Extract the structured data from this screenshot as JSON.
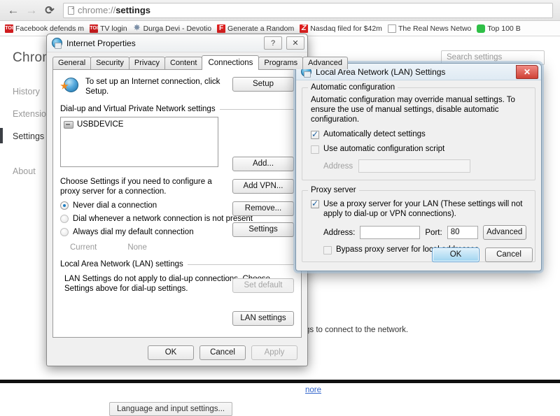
{
  "browser": {
    "nav": {
      "back": "←",
      "forward": "→",
      "reload": "⟳"
    },
    "omnibox": {
      "url_prefix": "chrome://",
      "url_page": "settings",
      "full_url": "chrome://settings"
    },
    "bookmarks": [
      {
        "label": "Facebook defends m",
        "icon": "toi-icon",
        "icon_text": "TOI"
      },
      {
        "label": "TV login",
        "icon": "toi-icon",
        "icon_text": "TOI"
      },
      {
        "label": "Durga Devi - Devotio",
        "icon": "star-icon",
        "icon_text": "✵"
      },
      {
        "label": "Generate a Random",
        "icon": "f-icon",
        "icon_text": "F"
      },
      {
        "label": "Nasdaq filed for $42m",
        "icon": "z-icon",
        "icon_text": "Z"
      },
      {
        "label": "The Real News Netwo",
        "icon": "document-icon",
        "icon_text": ""
      },
      {
        "label": "Top 100 B",
        "icon": "green-chat-icon",
        "icon_text": ""
      }
    ]
  },
  "settings_page": {
    "title": "Chrome",
    "sidebar": [
      {
        "label": "History",
        "active": false
      },
      {
        "label": "Extensions",
        "active": false
      },
      {
        "label": "Settings",
        "active": true
      },
      {
        "label": "About",
        "active": false
      }
    ],
    "search_placeholder": "Search settings",
    "visible_snippet": "gs to connect to the network.",
    "learn_more": "nore",
    "language_button": "Language and input settings..."
  },
  "internet_properties": {
    "title": "Internet Properties",
    "titlebar_buttons": {
      "help": "?",
      "close": "✕"
    },
    "tabs": [
      {
        "label": "General",
        "active": false
      },
      {
        "label": "Security",
        "active": false
      },
      {
        "label": "Privacy",
        "active": false
      },
      {
        "label": "Content",
        "active": false
      },
      {
        "label": "Connections",
        "active": true
      },
      {
        "label": "Programs",
        "active": false
      },
      {
        "label": "Advanced",
        "active": false
      }
    ],
    "setup_text": "To set up an Internet connection, click Setup.",
    "setup_button": "Setup",
    "dialup_group": "Dial-up and Virtual Private Network settings",
    "connection_list": [
      {
        "name": "USBDEVICE"
      }
    ],
    "add_button": "Add...",
    "add_vpn_button": "Add VPN...",
    "remove_button": "Remove...",
    "proxy_note": "Choose Settings if you need to configure a proxy server for a connection.",
    "settings_button": "Settings",
    "dial_options": [
      {
        "label": "Never dial a connection",
        "checked": true
      },
      {
        "label": "Dial whenever a network connection is not present",
        "checked": false
      },
      {
        "label": "Always dial my default connection",
        "checked": false
      }
    ],
    "current_label": "Current",
    "current_value": "None",
    "set_default_button": "Set default",
    "lan_group": "Local Area Network (LAN) settings",
    "lan_note": "LAN Settings do not apply to dial-up connections. Choose Settings above for dial-up settings.",
    "lan_settings_button": "LAN settings",
    "ok_button": "OK",
    "cancel_button": "Cancel",
    "apply_button": "Apply"
  },
  "lan_settings": {
    "title": "Local Area Network (LAN) Settings",
    "close_button": "✕",
    "auto_config": {
      "legend": "Automatic configuration",
      "description": "Automatic configuration may override manual settings.  To ensure the use of manual settings, disable automatic configuration.",
      "auto_detect_label": "Automatically detect settings",
      "auto_detect_checked": true,
      "use_script_label": "Use automatic configuration script",
      "use_script_checked": false,
      "address_label": "Address",
      "address_value": ""
    },
    "proxy_server": {
      "legend": "Proxy server",
      "use_proxy_label": "Use a proxy server for your LAN (These settings will not apply to dial-up or VPN connections).",
      "use_proxy_checked": true,
      "address_label": "Address:",
      "address_value": "",
      "port_label": "Port:",
      "port_value": "80",
      "advanced_button": "Advanced",
      "bypass_label": "Bypass proxy server for local addresses",
      "bypass_checked": false
    },
    "ok_button": "OK",
    "cancel_button": "Cancel"
  },
  "colors": {
    "accent_blue": "#1f7ec1",
    "close_red": "#cf4136",
    "link_blue": "#3366cc",
    "toi_red": "#d01c1f"
  }
}
